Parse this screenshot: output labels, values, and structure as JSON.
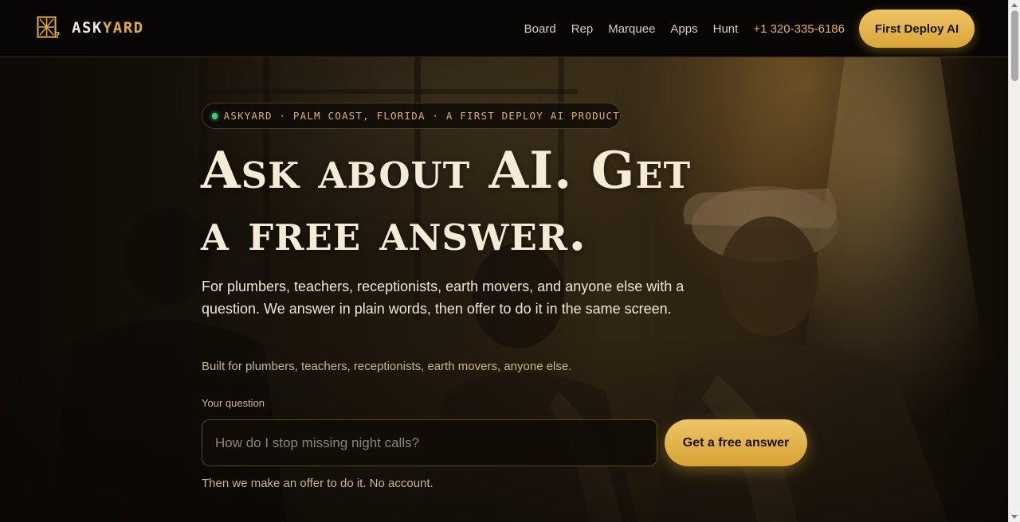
{
  "brand": {
    "name_a": "ASK",
    "name_b": "YARD",
    "logo_icon": "askyard-logo-icon"
  },
  "nav": {
    "items": [
      "Board",
      "Rep",
      "Marquee",
      "Apps",
      "Hunt"
    ],
    "phone": "+1 320-335-6186",
    "cta": "First Deploy AI"
  },
  "hero": {
    "eyebrow": "ASKYARD · PALM COAST, FLORIDA · A FIRST DEPLOY AI PRODUCT",
    "headline_line1": "Ask about AI. Get",
    "headline_line2": "a free answer.",
    "lede": "For plumbers, teachers, receptionists, earth movers, and anyone else with a question. We answer in plain words, then offer to do it in the same screen.",
    "sub": "Built for plumbers, teachers, receptionists, earth movers, anyone else.",
    "question_label": "Your question",
    "question_placeholder": "How do I stop missing night calls?",
    "question_value": "",
    "submit_label": "Get a free answer",
    "note": "Then we make an offer to do it. No account."
  },
  "colors": {
    "accent": "#e0ad3c",
    "status_dot": "#38d07a",
    "headline": "#f6ecd6"
  }
}
